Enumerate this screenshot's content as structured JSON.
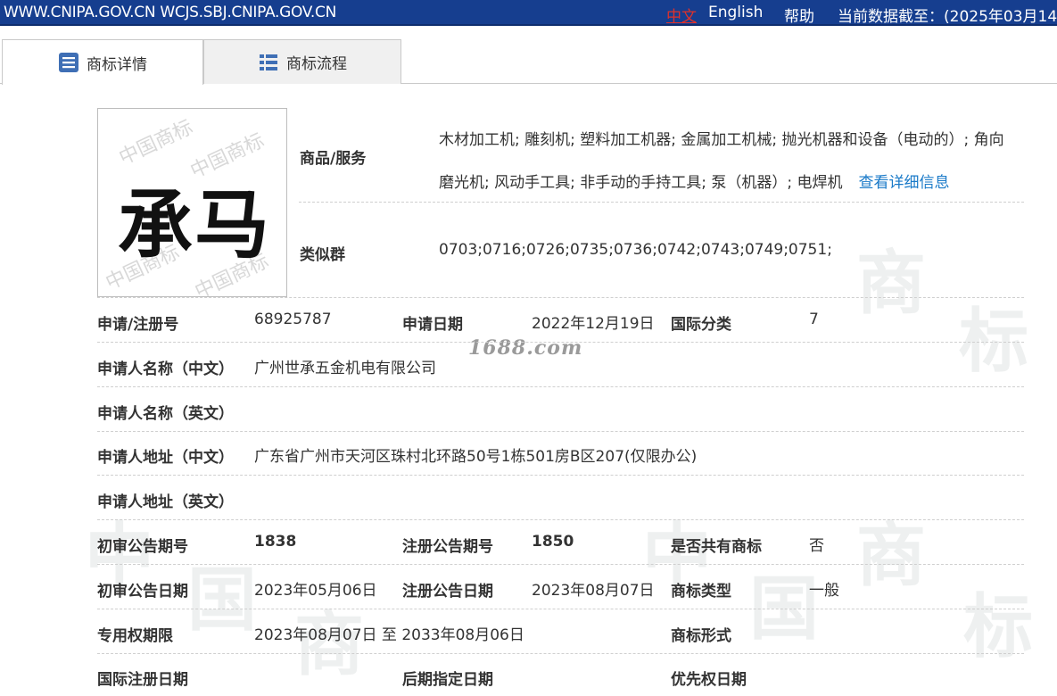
{
  "topbar": {
    "site": "WWW.CNIPA.GOV.CN WCJS.SBJ.CNIPA.GOV.CN",
    "lang_cn": "中文",
    "lang_en": "English",
    "help": "帮助",
    "as_of": "当前数据截至：(2025年03月14"
  },
  "tabs": [
    {
      "label": "商标详情",
      "icon": "list-doc-icon"
    },
    {
      "label": "商标流程",
      "icon": "list-icon"
    }
  ],
  "logo": {
    "mark_text": "承马",
    "watermark_text": "中国商标"
  },
  "watermark_text": "1688.com",
  "goods": {
    "label": "商品/服务",
    "line1": "木材加工机; 雕刻机; 塑料加工机器; 金属加工机械; 抛光机器和设备（电动的）; 角向",
    "line2": "磨光机; 风动手工具; 非手动的手持工具; 泵（机器）; 电焊机",
    "detail_link": "查看详细信息"
  },
  "similar_group": {
    "label": "类似群",
    "value": "0703;0716;0726;0735;0736;0742;0743;0749;0751;"
  },
  "rows": {
    "reg_no_label": "申请/注册号",
    "reg_no": "68925787",
    "app_date_label": "申请日期",
    "app_date": "2022年12月19日",
    "intl_class_label": "国际分类",
    "intl_class": "7",
    "applicant_cn_label": "申请人名称（中文）",
    "applicant_cn": "广州世承五金机电有限公司",
    "applicant_en_label": "申请人名称（英文）",
    "applicant_en": "",
    "address_cn_label": "申请人地址（中文）",
    "address_cn": "广东省广州市天河区珠村北环路50号1栋501房B区207(仅限办公)",
    "address_en_label": "申请人地址（英文）",
    "address_en": "",
    "prelim_no_label": "初审公告期号",
    "prelim_no": "1838",
    "reg_pub_no_label": "注册公告期号",
    "reg_pub_no": "1850",
    "shared_label": "是否共有商标",
    "shared": "否",
    "prelim_date_label": "初审公告日期",
    "prelim_date": "2023年05月06日",
    "reg_pub_date_label": "注册公告日期",
    "reg_pub_date": "2023年08月07日",
    "mark_type_label": "商标类型",
    "mark_type": "一般",
    "term_label": "专用权期限",
    "term": "2023年08月07日 至 2033年08月06日",
    "mark_form_label": "商标形式",
    "mark_form": "",
    "intl_reg_date_label": "国际注册日期",
    "intl_reg_date": "",
    "later_date_label": "后期指定日期",
    "later_date": "",
    "priority_date_label": "优先权日期",
    "priority_date": ""
  }
}
